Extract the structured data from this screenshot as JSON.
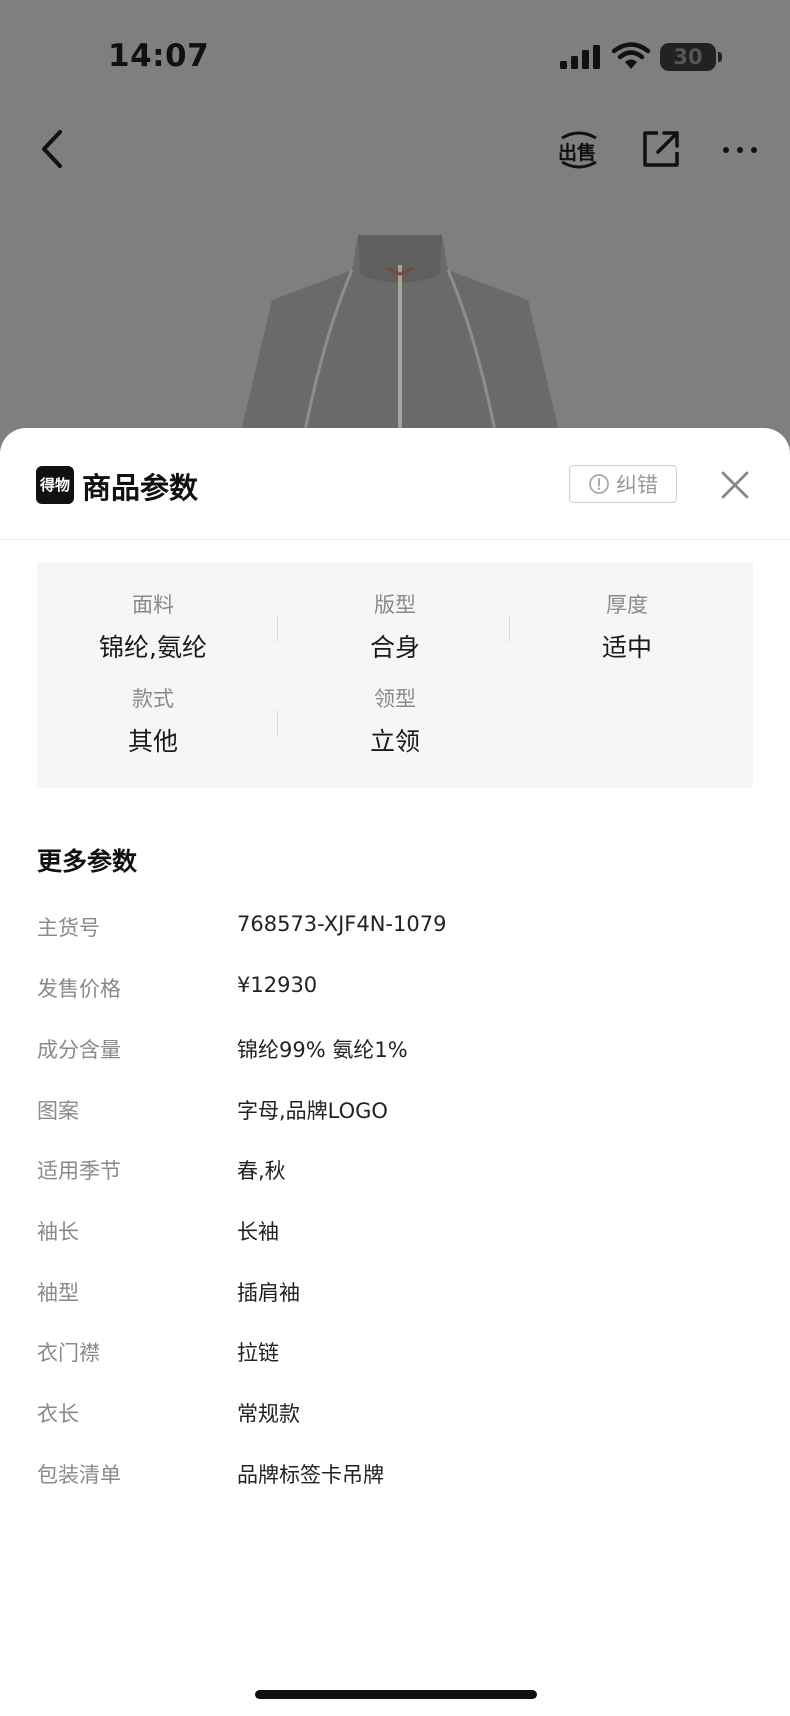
{
  "status_bar": {
    "time": "14:07",
    "battery": "30"
  },
  "nav": {
    "sell_label": "出售"
  },
  "sheet": {
    "logo_text": "得物",
    "title": "商品参数",
    "report_label": "纠错"
  },
  "key_params": [
    {
      "label": "面料",
      "value": "锦纶,氨纶"
    },
    {
      "label": "版型",
      "value": "合身"
    },
    {
      "label": "厚度",
      "value": "适中"
    },
    {
      "label": "款式",
      "value": "其他"
    },
    {
      "label": "领型",
      "value": "立领"
    }
  ],
  "more_params": {
    "title": "更多参数",
    "rows": [
      {
        "label": "主货号",
        "value": "768573-XJF4N-1079"
      },
      {
        "label": "发售价格",
        "value": "¥12930"
      },
      {
        "label": "成分含量",
        "value": "锦纶99% 氨纶1%"
      },
      {
        "label": "图案",
        "value": "字母,品牌LOGO"
      },
      {
        "label": "适用季节",
        "value": "春,秋"
      },
      {
        "label": "袖长",
        "value": "长袖"
      },
      {
        "label": "袖型",
        "value": "插肩袖"
      },
      {
        "label": "衣门襟",
        "value": "拉链"
      },
      {
        "label": "衣长",
        "value": "常规款"
      },
      {
        "label": "包装清单",
        "value": "品牌标签卡吊牌"
      }
    ]
  }
}
